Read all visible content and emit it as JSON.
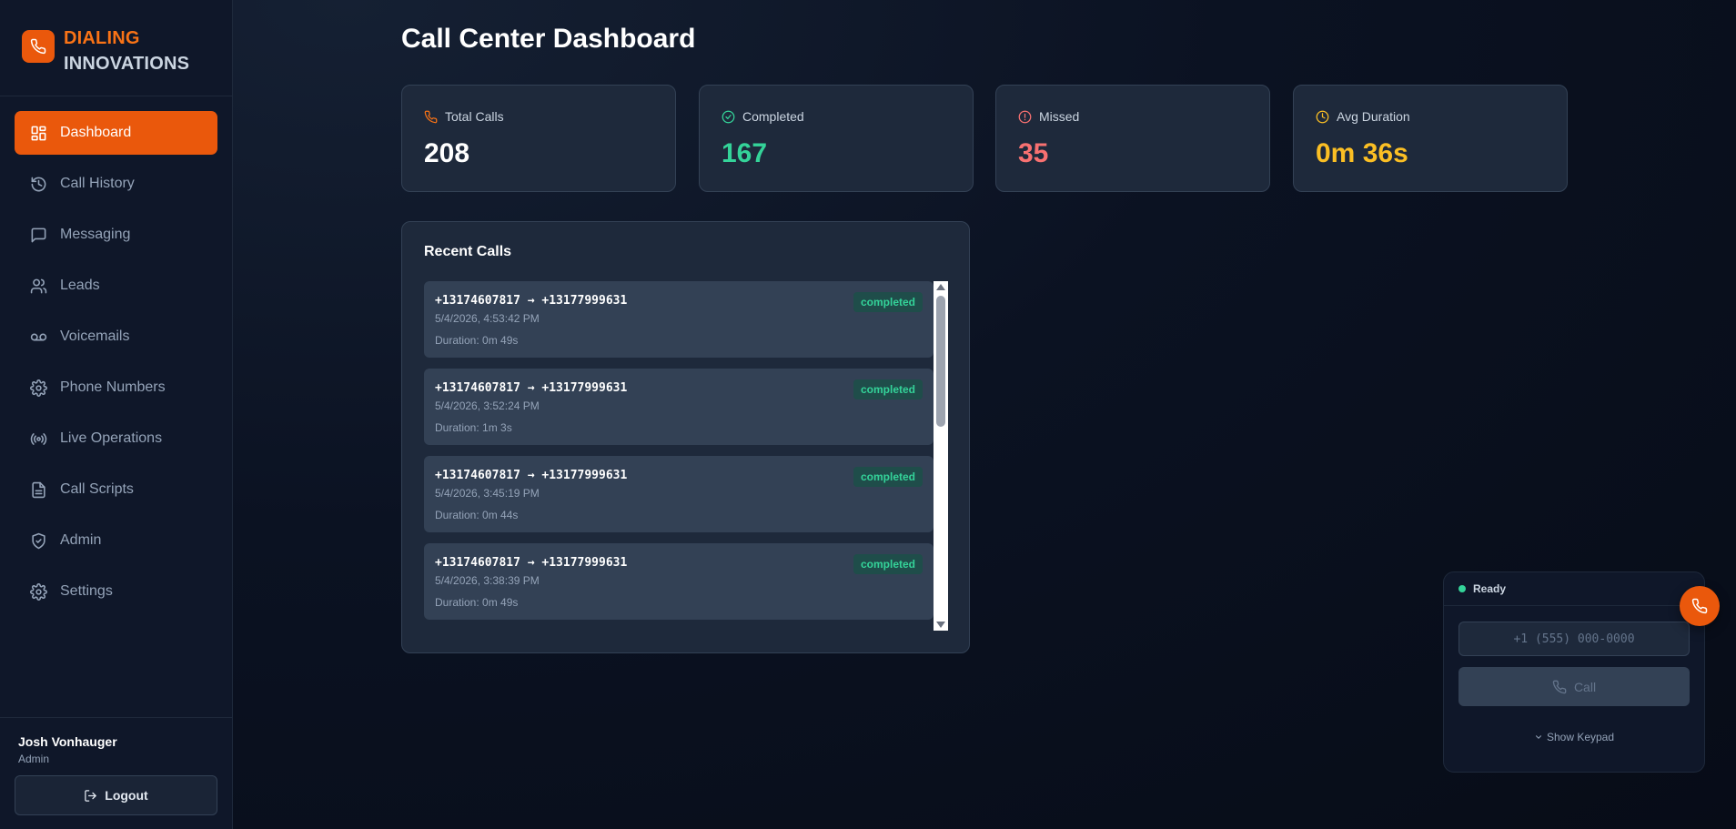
{
  "brand": {
    "line1": "DIALING",
    "line2": "INNOVATIONS",
    "icon": "phone-icon",
    "accent": "#f97316"
  },
  "sidebar": {
    "items": [
      {
        "label": "Dashboard",
        "icon": "dashboard-icon",
        "active": true
      },
      {
        "label": "Call History",
        "icon": "history-icon"
      },
      {
        "label": "Messaging",
        "icon": "message-icon"
      },
      {
        "label": "Leads",
        "icon": "users-icon"
      },
      {
        "label": "Voicemails",
        "icon": "voicemail-icon"
      },
      {
        "label": "Phone Numbers",
        "icon": "gear-icon"
      },
      {
        "label": "Live Operations",
        "icon": "radio-icon"
      },
      {
        "label": "Call Scripts",
        "icon": "document-icon"
      },
      {
        "label": "Admin",
        "icon": "shield-icon"
      },
      {
        "label": "Settings",
        "icon": "gear-icon"
      }
    ],
    "active_color": "#ea580c"
  },
  "user": {
    "name": "Josh Vonhauger",
    "role": "Admin",
    "logout_label": "Logout"
  },
  "main": {
    "title": "Call Center Dashboard",
    "stats": [
      {
        "label": "Total Calls",
        "value": "208",
        "icon": "phone-icon",
        "color": "#ffffff",
        "icon_color": "#f97316"
      },
      {
        "label": "Completed",
        "value": "167",
        "icon": "check-circle-icon",
        "color": "#34d399",
        "icon_color": "#34d399"
      },
      {
        "label": "Missed",
        "value": "35",
        "icon": "alert-circle-icon",
        "color": "#f87171",
        "icon_color": "#f87171"
      },
      {
        "label": "Avg Duration",
        "value": "0m 36s",
        "icon": "clock-icon",
        "color": "#fbbf24",
        "icon_color": "#fbbf24"
      }
    ],
    "recent_calls": {
      "title": "Recent Calls",
      "items": [
        {
          "numbers": "+13174607817 → +13177999631",
          "time": "5/4/2026, 4:53:42 PM",
          "duration": "Duration: 0m 49s",
          "status": "completed"
        },
        {
          "numbers": "+13174607817 → +13177999631",
          "time": "5/4/2026, 3:52:24 PM",
          "duration": "Duration: 1m 3s",
          "status": "completed"
        },
        {
          "numbers": "+13174607817 → +13177999631",
          "time": "5/4/2026, 3:45:19 PM",
          "duration": "Duration: 0m 44s",
          "status": "completed"
        },
        {
          "numbers": "+13174607817 → +13177999631",
          "time": "5/4/2026, 3:38:39 PM",
          "duration": "Duration: 0m 49s",
          "status": "completed"
        }
      ]
    }
  },
  "dialer": {
    "status": "Ready",
    "status_color": "#34d399",
    "input_placeholder": "+1 (555) 000-0000",
    "input_value": "",
    "call_label": "Call",
    "keypad_label": "Show Keypad"
  }
}
